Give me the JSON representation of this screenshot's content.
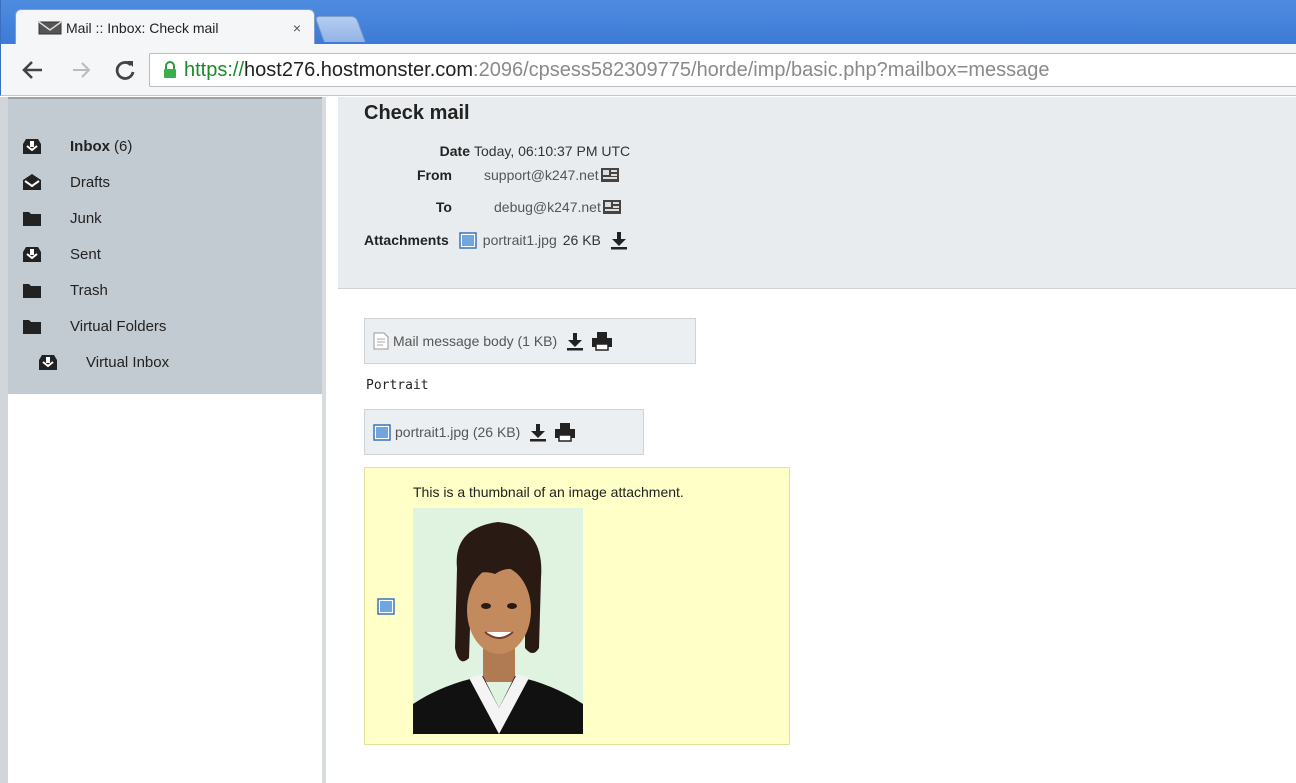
{
  "browser": {
    "tab_title": "Mail :: Inbox: Check mail",
    "tab_close": "×",
    "url_scheme": "https://",
    "url_host": "host276.hostmonster.com",
    "url_path": ":2096/cpsess582309775/horde/imp/basic.php?mailbox=message"
  },
  "sidebar": {
    "folders": [
      {
        "label": "Inbox",
        "count": "(6)",
        "icon": "inbox-icon"
      },
      {
        "label": "Drafts",
        "icon": "drafts-icon"
      },
      {
        "label": "Junk",
        "icon": "folder-icon"
      },
      {
        "label": "Sent",
        "icon": "sent-icon"
      },
      {
        "label": "Trash",
        "icon": "folder-icon"
      },
      {
        "label": "Virtual Folders",
        "icon": "folder-icon"
      },
      {
        "label": "Virtual Inbox",
        "icon": "inbox-icon"
      }
    ]
  },
  "message": {
    "title": "Check mail",
    "date_label": "Date",
    "date_value": "Today, 06:10:37 PM UTC",
    "from_label": "From",
    "from_value": "support@k247.net",
    "to_label": "To",
    "to_value": "debug@k247.net",
    "attachments_label": "Attachments",
    "attachment_name": "portrait1.jpg",
    "attachment_size": "26 KB"
  },
  "parts": {
    "body_part_label": "Mail message body (1 KB)",
    "body_text": "Portrait",
    "image_part_label": "portrait1.jpg (26 KB)",
    "thumbnail_caption": "This is a thumbnail of an image attachment."
  },
  "colors": {
    "tabstrip": "#3d7ad6",
    "sidebar_panel": "#c3cbd2",
    "header_panel": "#e9ecee",
    "thumbnail_bg": "#ffffc8",
    "secure_green": "#1a8a2a"
  }
}
